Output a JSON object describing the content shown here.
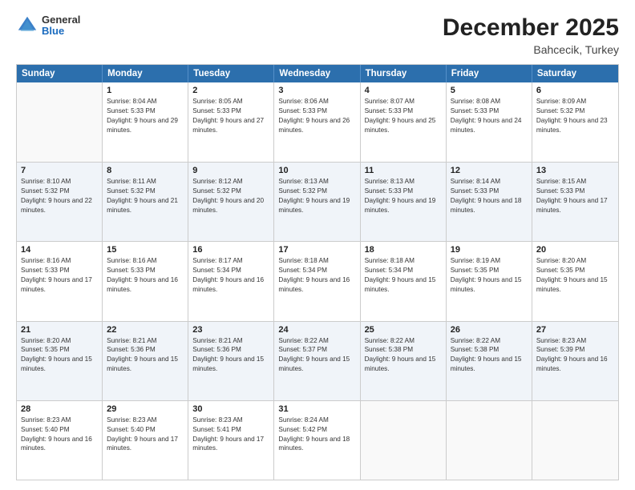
{
  "header": {
    "logo": {
      "general": "General",
      "blue": "Blue"
    },
    "title": "December 2025",
    "location": "Bahcecik, Turkey"
  },
  "calendar": {
    "days": [
      "Sunday",
      "Monday",
      "Tuesday",
      "Wednesday",
      "Thursday",
      "Friday",
      "Saturday"
    ],
    "rows": [
      [
        {
          "day": "",
          "sunrise": "",
          "sunset": "",
          "daylight": ""
        },
        {
          "day": "1",
          "sunrise": "Sunrise: 8:04 AM",
          "sunset": "Sunset: 5:33 PM",
          "daylight": "Daylight: 9 hours and 29 minutes."
        },
        {
          "day": "2",
          "sunrise": "Sunrise: 8:05 AM",
          "sunset": "Sunset: 5:33 PM",
          "daylight": "Daylight: 9 hours and 27 minutes."
        },
        {
          "day": "3",
          "sunrise": "Sunrise: 8:06 AM",
          "sunset": "Sunset: 5:33 PM",
          "daylight": "Daylight: 9 hours and 26 minutes."
        },
        {
          "day": "4",
          "sunrise": "Sunrise: 8:07 AM",
          "sunset": "Sunset: 5:33 PM",
          "daylight": "Daylight: 9 hours and 25 minutes."
        },
        {
          "day": "5",
          "sunrise": "Sunrise: 8:08 AM",
          "sunset": "Sunset: 5:33 PM",
          "daylight": "Daylight: 9 hours and 24 minutes."
        },
        {
          "day": "6",
          "sunrise": "Sunrise: 8:09 AM",
          "sunset": "Sunset: 5:32 PM",
          "daylight": "Daylight: 9 hours and 23 minutes."
        }
      ],
      [
        {
          "day": "7",
          "sunrise": "Sunrise: 8:10 AM",
          "sunset": "Sunset: 5:32 PM",
          "daylight": "Daylight: 9 hours and 22 minutes."
        },
        {
          "day": "8",
          "sunrise": "Sunrise: 8:11 AM",
          "sunset": "Sunset: 5:32 PM",
          "daylight": "Daylight: 9 hours and 21 minutes."
        },
        {
          "day": "9",
          "sunrise": "Sunrise: 8:12 AM",
          "sunset": "Sunset: 5:32 PM",
          "daylight": "Daylight: 9 hours and 20 minutes."
        },
        {
          "day": "10",
          "sunrise": "Sunrise: 8:13 AM",
          "sunset": "Sunset: 5:32 PM",
          "daylight": "Daylight: 9 hours and 19 minutes."
        },
        {
          "day": "11",
          "sunrise": "Sunrise: 8:13 AM",
          "sunset": "Sunset: 5:33 PM",
          "daylight": "Daylight: 9 hours and 19 minutes."
        },
        {
          "day": "12",
          "sunrise": "Sunrise: 8:14 AM",
          "sunset": "Sunset: 5:33 PM",
          "daylight": "Daylight: 9 hours and 18 minutes."
        },
        {
          "day": "13",
          "sunrise": "Sunrise: 8:15 AM",
          "sunset": "Sunset: 5:33 PM",
          "daylight": "Daylight: 9 hours and 17 minutes."
        }
      ],
      [
        {
          "day": "14",
          "sunrise": "Sunrise: 8:16 AM",
          "sunset": "Sunset: 5:33 PM",
          "daylight": "Daylight: 9 hours and 17 minutes."
        },
        {
          "day": "15",
          "sunrise": "Sunrise: 8:16 AM",
          "sunset": "Sunset: 5:33 PM",
          "daylight": "Daylight: 9 hours and 16 minutes."
        },
        {
          "day": "16",
          "sunrise": "Sunrise: 8:17 AM",
          "sunset": "Sunset: 5:34 PM",
          "daylight": "Daylight: 9 hours and 16 minutes."
        },
        {
          "day": "17",
          "sunrise": "Sunrise: 8:18 AM",
          "sunset": "Sunset: 5:34 PM",
          "daylight": "Daylight: 9 hours and 16 minutes."
        },
        {
          "day": "18",
          "sunrise": "Sunrise: 8:18 AM",
          "sunset": "Sunset: 5:34 PM",
          "daylight": "Daylight: 9 hours and 15 minutes."
        },
        {
          "day": "19",
          "sunrise": "Sunrise: 8:19 AM",
          "sunset": "Sunset: 5:35 PM",
          "daylight": "Daylight: 9 hours and 15 minutes."
        },
        {
          "day": "20",
          "sunrise": "Sunrise: 8:20 AM",
          "sunset": "Sunset: 5:35 PM",
          "daylight": "Daylight: 9 hours and 15 minutes."
        }
      ],
      [
        {
          "day": "21",
          "sunrise": "Sunrise: 8:20 AM",
          "sunset": "Sunset: 5:35 PM",
          "daylight": "Daylight: 9 hours and 15 minutes."
        },
        {
          "day": "22",
          "sunrise": "Sunrise: 8:21 AM",
          "sunset": "Sunset: 5:36 PM",
          "daylight": "Daylight: 9 hours and 15 minutes."
        },
        {
          "day": "23",
          "sunrise": "Sunrise: 8:21 AM",
          "sunset": "Sunset: 5:36 PM",
          "daylight": "Daylight: 9 hours and 15 minutes."
        },
        {
          "day": "24",
          "sunrise": "Sunrise: 8:22 AM",
          "sunset": "Sunset: 5:37 PM",
          "daylight": "Daylight: 9 hours and 15 minutes."
        },
        {
          "day": "25",
          "sunrise": "Sunrise: 8:22 AM",
          "sunset": "Sunset: 5:38 PM",
          "daylight": "Daylight: 9 hours and 15 minutes."
        },
        {
          "day": "26",
          "sunrise": "Sunrise: 8:22 AM",
          "sunset": "Sunset: 5:38 PM",
          "daylight": "Daylight: 9 hours and 15 minutes."
        },
        {
          "day": "27",
          "sunrise": "Sunrise: 8:23 AM",
          "sunset": "Sunset: 5:39 PM",
          "daylight": "Daylight: 9 hours and 16 minutes."
        }
      ],
      [
        {
          "day": "28",
          "sunrise": "Sunrise: 8:23 AM",
          "sunset": "Sunset: 5:40 PM",
          "daylight": "Daylight: 9 hours and 16 minutes."
        },
        {
          "day": "29",
          "sunrise": "Sunrise: 8:23 AM",
          "sunset": "Sunset: 5:40 PM",
          "daylight": "Daylight: 9 hours and 17 minutes."
        },
        {
          "day": "30",
          "sunrise": "Sunrise: 8:23 AM",
          "sunset": "Sunset: 5:41 PM",
          "daylight": "Daylight: 9 hours and 17 minutes."
        },
        {
          "day": "31",
          "sunrise": "Sunrise: 8:24 AM",
          "sunset": "Sunset: 5:42 PM",
          "daylight": "Daylight: 9 hours and 18 minutes."
        },
        {
          "day": "",
          "sunrise": "",
          "sunset": "",
          "daylight": ""
        },
        {
          "day": "",
          "sunrise": "",
          "sunset": "",
          "daylight": ""
        },
        {
          "day": "",
          "sunrise": "",
          "sunset": "",
          "daylight": ""
        }
      ]
    ]
  }
}
